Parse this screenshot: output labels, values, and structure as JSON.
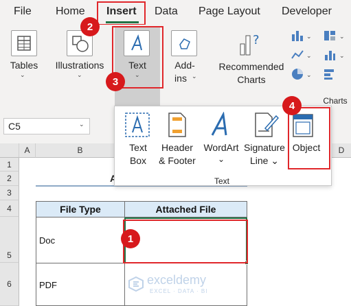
{
  "tabs": [
    "File",
    "Home",
    "Insert",
    "Data",
    "Page Layout",
    "Developer"
  ],
  "ribbon": {
    "tables_label": "Tables",
    "illustrations_label": "Illustrations",
    "text_label": "Text",
    "addins_label": "Add-ins",
    "addins_line1": "Add-",
    "addins_line2": "ins",
    "recommended_charts_line1": "Recommended",
    "recommended_charts_line2": "Charts",
    "charts_group_label": "Charts"
  },
  "name_box": "C5",
  "text_menu": {
    "items": [
      {
        "line1": "Text",
        "line2": "Box"
      },
      {
        "line1": "Header",
        "line2": "& Footer"
      },
      {
        "line1": "WordArt",
        "line2": "⌄"
      },
      {
        "line1": "Signature",
        "line2": "Line ⌄"
      },
      {
        "line1": "Object",
        "line2": ""
      }
    ],
    "group_label": "Text"
  },
  "columns": [
    "A",
    "B",
    "D"
  ],
  "rows": [
    "1",
    "2",
    "3",
    "4",
    "5",
    "6"
  ],
  "partial_title": "A",
  "table": {
    "headers": [
      "File Type",
      "Attached File"
    ],
    "rows": [
      {
        "type": "Doc",
        "file": ""
      },
      {
        "type": "PDF",
        "file": ""
      }
    ]
  },
  "badges": [
    "1",
    "2",
    "3",
    "4"
  ],
  "watermark": {
    "name": "exceldemy",
    "tagline": "EXCEL · DATA · BI"
  },
  "colors": {
    "accent_red": "#e0262a",
    "excel_green": "#217346",
    "header_fill": "#dbeaf7"
  }
}
